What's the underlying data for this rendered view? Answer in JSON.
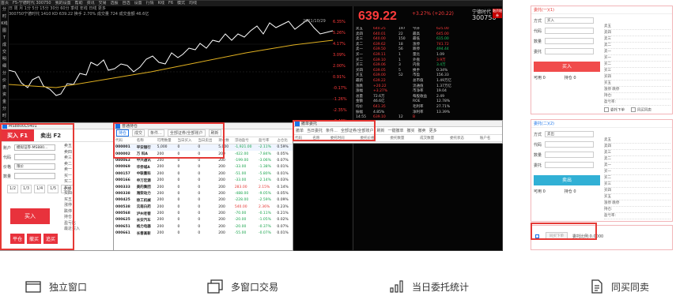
{
  "terminal": {
    "menubar": [
      "首页",
      "F5-宁德时代 300750",
      "我的设置",
      "帮助",
      "资讯",
      "交易",
      "选股",
      "自选",
      "设置",
      "行情",
      "K线",
      "F6",
      "模式",
      "均线"
    ],
    "sidebar": [
      "分时",
      "K线图",
      "T",
      "成交明细",
      "分价表",
      "资金",
      "分时",
      "行情"
    ],
    "subbar_lines": [
      "日 周 月 1分 5分 15分 30分 60分 季线 年线 日线 更多",
      "300750宁德时代 1410 KD 639.22 换手 2.70% 成交量 724 成交金额 46.6亿"
    ],
    "chart_date": "2021/10/29",
    "axis_labels": [
      "6.35%",
      "5.26%",
      "4.17%",
      "3.09%",
      "2.00%",
      "0.91%",
      "-0.17%",
      "-1.26%",
      "-2.35%",
      "-3.43%"
    ],
    "quote": {
      "price": "639.22",
      "change": "+3.27% (+20.22)",
      "name": "宁德时代",
      "code": "300750",
      "tag": "融资融券",
      "rows": [
        [
          [
            "卖五",
            ""
          ],
          [
            "640.25",
            "r"
          ],
          [
            "197",
            ""
          ],
          [
            "今开",
            ""
          ],
          [
            "625.00",
            "r"
          ]
        ],
        [
          [
            "卖四",
            ""
          ],
          [
            "640.01",
            "r"
          ],
          [
            "22",
            ""
          ],
          [
            "最高",
            ""
          ],
          [
            "645.00",
            "r"
          ]
        ],
        [
          [
            "卖三",
            ""
          ],
          [
            "640.00",
            "r"
          ],
          [
            "150",
            ""
          ],
          [
            "最低",
            ""
          ],
          [
            "615.00",
            "g"
          ]
        ],
        [
          [
            "卖二",
            ""
          ],
          [
            "639.62",
            "r"
          ],
          [
            "18",
            ""
          ],
          [
            "涨停",
            ""
          ],
          [
            "741.72",
            "r"
          ]
        ],
        [
          [
            "卖一",
            ""
          ],
          [
            "639.50",
            "r"
          ],
          [
            "56",
            ""
          ],
          [
            "跌停",
            ""
          ],
          [
            "494.44",
            "g"
          ]
        ],
        [
          [
            "买一",
            ""
          ],
          [
            "639.11",
            "r"
          ],
          [
            "1",
            ""
          ],
          [
            "量比",
            ""
          ],
          [
            "1.09",
            ""
          ]
        ],
        [
          [
            "买二",
            ""
          ],
          [
            "639.10",
            "r"
          ],
          [
            "1",
            ""
          ],
          [
            "外盘",
            ""
          ],
          [
            "3.9万",
            "r"
          ]
        ],
        [
          [
            "买三",
            ""
          ],
          [
            "639.06",
            "r"
          ],
          [
            "3",
            ""
          ],
          [
            "内盘",
            ""
          ],
          [
            "3.4万",
            "g"
          ]
        ],
        [
          [
            "买四",
            ""
          ],
          [
            "639.05",
            "r"
          ],
          [
            "5",
            ""
          ],
          [
            "换手",
            ""
          ],
          [
            "0.34%",
            ""
          ]
        ],
        [
          [
            "买五",
            ""
          ],
          [
            "639.00",
            "r"
          ],
          [
            "52",
            ""
          ],
          [
            "市盈",
            ""
          ],
          [
            "156.33",
            ""
          ]
        ],
        [
          [
            "最新",
            ""
          ],
          [
            "639.22",
            "r"
          ],
          [
            "",
            ""
          ],
          [
            "总市值",
            ""
          ],
          [
            "1.49万亿",
            ""
          ]
        ],
        [
          [
            "涨跌",
            ""
          ],
          [
            "+20.22",
            "r"
          ],
          [
            "",
            ""
          ],
          [
            "流通值",
            ""
          ],
          [
            "1.37万亿",
            ""
          ]
        ],
        [
          [
            "涨幅",
            ""
          ],
          [
            "+3.27%",
            "r"
          ],
          [
            "",
            ""
          ],
          [
            "市净率",
            ""
          ],
          [
            "19.04",
            ""
          ]
        ],
        [
          [
            "总量",
            ""
          ],
          [
            "72.6万",
            ""
          ],
          [
            "",
            ""
          ],
          [
            "每股收益",
            ""
          ],
          [
            "2.49",
            ""
          ]
        ],
        [
          [
            "金额",
            ""
          ],
          [
            "46.6亿",
            ""
          ],
          [
            "",
            ""
          ],
          [
            "ROE",
            ""
          ],
          [
            "12.78%",
            ""
          ]
        ],
        [
          [
            "均价",
            ""
          ],
          [
            "641.35",
            "r"
          ],
          [
            "",
            ""
          ],
          [
            "毛利率",
            ""
          ],
          [
            "27.71%",
            ""
          ]
        ],
        [
          [
            "振幅",
            ""
          ],
          [
            "4.85%",
            ""
          ],
          [
            "",
            ""
          ],
          [
            "净利率",
            ""
          ],
          [
            "13.39%",
            ""
          ]
        ],
        [
          [
            "14:55",
            ""
          ],
          [
            "639.10",
            "r"
          ],
          [
            "12",
            ""
          ],
          [
            "B",
            "r"
          ],
          [
            "",
            ""
          ]
        ],
        [
          [
            "14:56",
            ""
          ],
          [
            "639.22",
            "r"
          ],
          [
            "30",
            ""
          ],
          [
            "B",
            "r"
          ],
          [
            "",
            ""
          ]
        ],
        [
          [
            "14:56",
            ""
          ],
          [
            "639.00",
            "g"
          ],
          [
            "8",
            ""
          ],
          [
            "S",
            "g"
          ],
          [
            "",
            ""
          ]
        ],
        [
          [
            "14:57",
            ""
          ],
          [
            "639.22",
            "r"
          ],
          [
            "4",
            ""
          ],
          [
            "B",
            "r"
          ],
          [
            "",
            ""
          ]
        ],
        [
          [
            "15:00",
            ""
          ],
          [
            "639.22",
            "r"
          ],
          [
            "1258",
            ""
          ],
          [
            "B",
            "r"
          ],
          [
            "",
            ""
          ]
        ]
      ]
    }
  },
  "order_window": {
    "title": "MS8800L5401",
    "tab_buy": "买入 F1",
    "tab_sell": "卖出 F2",
    "account_label": "账户",
    "account_value": "模拟证券-MS880...",
    "code_label": "代码",
    "price_label": "价格",
    "price_value": "限价",
    "qty_label": "数量",
    "fractions": [
      "1/2",
      "1/3",
      "1/4",
      "1/5",
      "全部"
    ],
    "buy_button": "买入",
    "bottom_buttons": [
      "平仓",
      "撤买",
      "追买"
    ],
    "side_items": [
      "卖五",
      "卖四",
      "卖三",
      "卖二",
      "卖一",
      "买一",
      "买二",
      "买三",
      "买四",
      "买五",
      "涨停",
      "跌停",
      "持仓",
      "盈亏比",
      "最近买入"
    ]
  },
  "hold_window": {
    "title": "普通持仓",
    "toolbar": [
      "持仓",
      "成交",
      "条件...",
      "全部证券/全部账户",
      "刷新"
    ],
    "headers": [
      "代码",
      "名称",
      "可用数量",
      "当日买入",
      "当日卖出",
      "持仓数",
      "浮动盈亏",
      "盈亏率",
      "占仓比"
    ],
    "rows": [
      [
        "000001",
        "平安银行",
        "5,000",
        "0",
        "0",
        "5,000",
        "-1,921.00",
        "-2.11%",
        "0.59%"
      ],
      [
        "000002",
        "万 科A",
        "200",
        "0",
        "0",
        "200",
        "-422.00",
        "-7.84%",
        "0.05%"
      ],
      [
        "000063",
        "中兴通讯",
        "200",
        "0",
        "0",
        "200",
        "-199.00",
        "-3.06%",
        "0.07%"
      ],
      [
        "000069",
        "华侨城A",
        "200",
        "0",
        "0",
        "200",
        "-33.00",
        "-1.38%",
        "0.01%"
      ],
      [
        "000157",
        "中联重科",
        "200",
        "0",
        "0",
        "200",
        "-51.00",
        "-5.80%",
        "0.01%"
      ],
      [
        "000166",
        "申万宏源",
        "200",
        "0",
        "0",
        "200",
        "-33.00",
        "-2.14%",
        "0.03%"
      ],
      [
        "000333",
        "美的集团",
        "200",
        "0",
        "0",
        "200",
        "283.00",
        "2.15%",
        "0.14%"
      ],
      [
        "000338",
        "潍柴动力",
        "200",
        "0",
        "0",
        "200",
        "-488.00",
        "-9.05%",
        "0.05%"
      ],
      [
        "000425",
        "徐工机械",
        "200",
        "0",
        "0",
        "200",
        "-228.00",
        "-2.59%",
        "0.09%"
      ],
      [
        "000538",
        "云南白药",
        "200",
        "0",
        "0",
        "200",
        "540.00",
        "2.36%",
        "0.23%"
      ],
      [
        "000568",
        "泸州老窖",
        "200",
        "0",
        "0",
        "200",
        "-70.00",
        "-0.11%",
        "0.21%"
      ],
      [
        "000625",
        "长安汽车",
        "200",
        "0",
        "0",
        "200",
        "-20.00",
        "-1.05%",
        "0.02%"
      ],
      [
        "000651",
        "格力电器",
        "200",
        "0",
        "0",
        "200",
        "-20.00",
        "-0.37%",
        "0.07%"
      ],
      [
        "000661",
        "长春高新",
        "200",
        "0",
        "0",
        "200",
        "-55.00",
        "-0.07%",
        "0.01%"
      ]
    ]
  },
  "entrust_window": {
    "title": "撤单委托",
    "toolbar": [
      "撤单",
      "当日委托",
      "条件...",
      "全部证券/全部账户",
      "刷新",
      "一键撤单",
      "撤买",
      "撤卖",
      "更多"
    ],
    "headers": [
      "代码",
      "名称",
      "委托时间",
      "委托价格",
      "委托数量",
      "成交数量",
      "委托状态",
      "账户名"
    ]
  },
  "buy_panel": {
    "head": "委托(一)(1)",
    "direction_label": "方式",
    "direction_value": "买入",
    "code_label": "代码",
    "qty_label": "数量",
    "price_label": "委托",
    "button": "买入",
    "avail_label": "可用",
    "avail_value": "0",
    "hold_label": "持仓",
    "hold_value": "0",
    "side": [
      "卖五",
      "卖四",
      "卖三",
      "卖二",
      "卖一",
      "买一",
      "买二",
      "买三",
      "买四",
      "买五",
      "涨停 跌停",
      "持仓:",
      "盈亏率:"
    ],
    "checks": [
      "委托下单",
      "同买同卖"
    ]
  },
  "sell_panel": {
    "head": "委托(二)(2)",
    "direction_label": "方式",
    "direction_value": "卖出",
    "code_label": "代码",
    "qty_label": "数量",
    "price_label": "委托",
    "button": "卖出",
    "avail_label": "可用",
    "avail_value": "0",
    "hold_label": "持仓",
    "hold_value": "0",
    "side": [
      "卖五",
      "卖四",
      "卖三",
      "卖二",
      "卖一",
      "买一",
      "买二",
      "买三",
      "买四",
      "买五",
      "涨停 跌停",
      "持仓:",
      "盈亏率:"
    ]
  },
  "footer_panel": {
    "button": "同买下单",
    "text": "委托比例:0.0000"
  },
  "features": [
    {
      "icon": "window-icon",
      "label": "独立窗口"
    },
    {
      "icon": "multi-window-icon",
      "label": "多窗口交易"
    },
    {
      "icon": "bar-stats-icon",
      "label": "当日委托统计"
    },
    {
      "icon": "document-icon",
      "label": "同买同卖"
    }
  ]
}
